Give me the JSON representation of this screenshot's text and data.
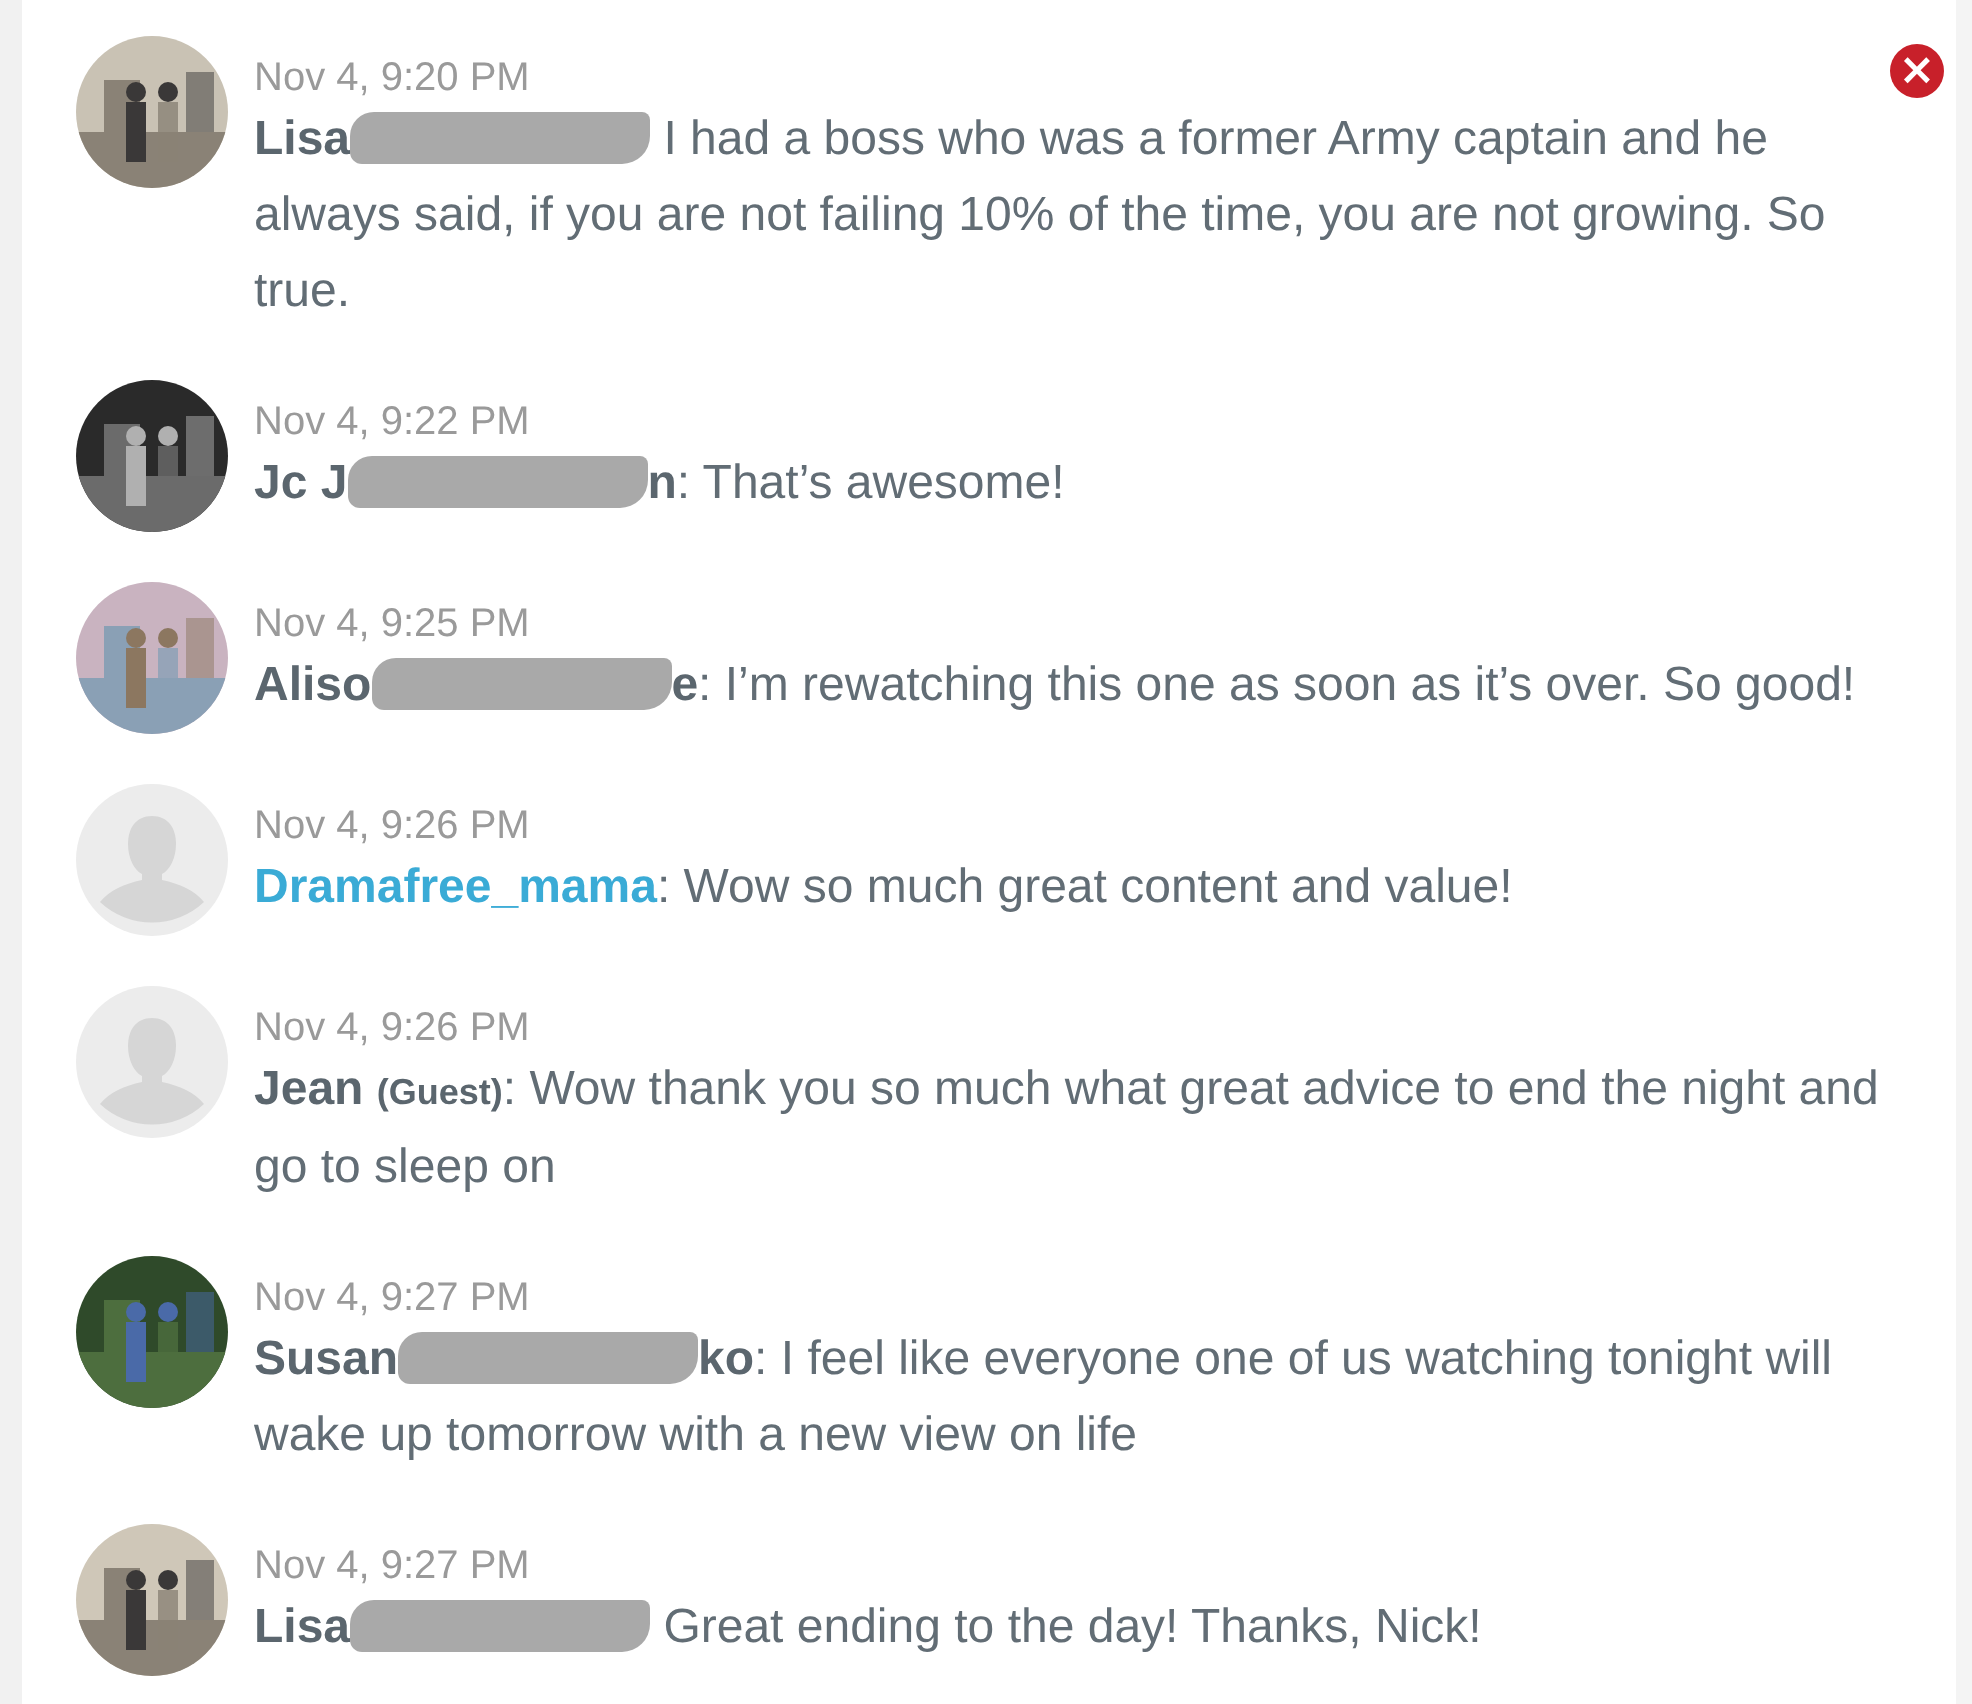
{
  "close_button": {
    "label": "×"
  },
  "messages": [
    {
      "time": "Nov 4, 9:20 PM",
      "name": "Lisa",
      "redacted": true,
      "text": " I had a boss who was a former Army captain and he always said, if you are not failing 10% of the time, you are not growing. So true."
    },
    {
      "time": "Nov 4, 9:22 PM",
      "name": "Jc J",
      "redacted": true,
      "name_tail": "n",
      "text": ": That’s awesome!"
    },
    {
      "time": "Nov 4, 9:25 PM",
      "name": "Aliso",
      "redacted": true,
      "name_tail": "e",
      "text": ": I’m rewatching this one as soon as it’s over. So good!"
    },
    {
      "avatar": {
        "kind": "default"
      },
      "time": "Nov 4, 9:26 PM",
      "name": "Dramafree_mama",
      "redacted": false,
      "color": "#3aabd6",
      "text": ": Wow so much great content and value!"
    },
    {
      "avatar": {
        "kind": "default"
      },
      "time": "Nov 4, 9:26 PM",
      "name": "Jean",
      "redacted": false,
      "guest": "(Guest)",
      "text": ": Wow thank you so much what great advice to end the night and go to sleep on"
    },
    {
      "time": "Nov 4, 9:27 PM",
      "name": "Susan",
      "redacted": true,
      "name_tail": "ko",
      "text": ": I feel like everyone one of us watching tonight will wake up tomorrow with a new view on life"
    },
    {
      "time": "Nov 4, 9:27 PM",
      "name": "Lisa",
      "redacted": true,
      "text": " Great ending to the day! Thanks, Nick!"
    }
  ]
}
